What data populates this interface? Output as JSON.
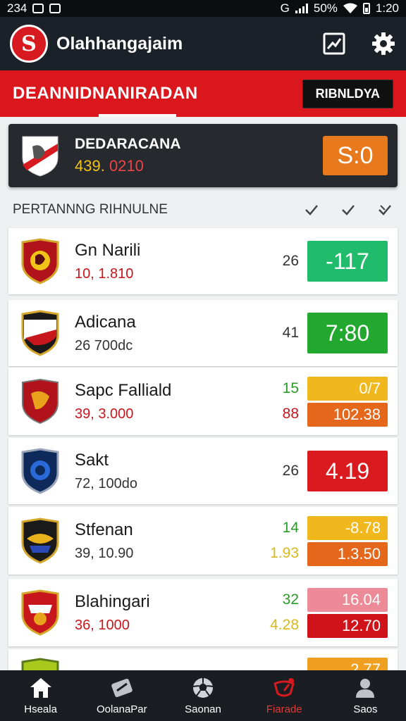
{
  "status_bar": {
    "time_left": "234",
    "signal": "G",
    "battery": "50%",
    "time_right": "1:20"
  },
  "app": {
    "logo_letter": "S",
    "title": "Olahhangajaim"
  },
  "red_bar": {
    "title": "DEANNIDNANIRADAN",
    "button": "RIBNLDYA"
  },
  "featured": {
    "name": "DEDARACANA",
    "sub_a": "439. ",
    "sub_b": "0210",
    "score": "S:0",
    "score_color": "#e8791c"
  },
  "section": {
    "title": "PERTANNNG RIHNULNE"
  },
  "rows": [
    {
      "name": "Gn Narili",
      "sub": "10, 1.810",
      "sub_red": true,
      "num1": "26",
      "num1_color": "#333333",
      "num2": "",
      "num2_color": "",
      "odd1": "-117",
      "odd1_color": "#21bb6c",
      "odd2": "",
      "odd2_color": ""
    },
    {
      "name": "Adicana",
      "sub": "26 700dc",
      "sub_red": false,
      "num1": "41",
      "num1_color": "#333333",
      "num2": "",
      "num2_color": "",
      "odd1": "7:80",
      "odd1_color": "#22a82e",
      "odd2": "",
      "odd2_color": ""
    },
    {
      "name": "Sapc Falliald",
      "sub": "39, 3.000",
      "sub_red": true,
      "num1": "15",
      "num1_color": "#2a9a2a",
      "num2": "88",
      "num2_color": "#c8161d",
      "odd1": "0/7",
      "odd1_color": "#f0b81c",
      "odd2": "102.38",
      "odd2_color": "#e5671c"
    },
    {
      "name": "Sakt",
      "sub": "72, 100do",
      "sub_red": false,
      "num1": "26",
      "num1_color": "#333333",
      "num2": "",
      "num2_color": "",
      "odd1": "4.19",
      "odd1_color": "#d91a1f",
      "odd2": "",
      "odd2_color": ""
    },
    {
      "name": "Stfenan",
      "sub": "39, 10.90",
      "sub_red": false,
      "num1": "14",
      "num1_color": "#2a9a2a",
      "num2": "1.93",
      "num2_color": "#d9b81c",
      "odd1": "-8.78",
      "odd1_color": "#f0b81c",
      "odd2": "1.3.50",
      "odd2_color": "#e5671c"
    },
    {
      "name": "Blahingari",
      "sub": "36, 1000",
      "sub_red": true,
      "num1": "32",
      "num1_color": "#2a9a2a",
      "num2": "4.28",
      "num2_color": "#d9b81c",
      "odd1": "16.04",
      "odd1_color": "#ec8a98",
      "odd2": "12.70",
      "odd2_color": "#d0121b"
    },
    {
      "name": "",
      "sub": "",
      "sub_red": false,
      "num1": "",
      "num1_color": "#333333",
      "num2": "",
      "num2_color": "",
      "odd1": "2.77",
      "odd1_color": "#f0a020",
      "odd2": "",
      "odd2_color": ""
    }
  ],
  "bottom_nav": [
    {
      "label": "Hseala",
      "icon": "home-icon",
      "active": false
    },
    {
      "label": "OolanaPar",
      "icon": "ticket-icon",
      "active": false
    },
    {
      "label": "Saonan",
      "icon": "soccer-ball-icon",
      "active": false
    },
    {
      "label": "Fiarade",
      "icon": "favorite-icon",
      "active": true
    },
    {
      "label": "Saos",
      "icon": "profile-icon",
      "active": false
    }
  ]
}
